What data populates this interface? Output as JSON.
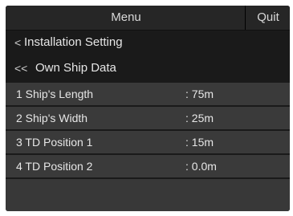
{
  "header": {
    "title": "Menu",
    "quit_label": "Quit"
  },
  "breadcrumb": [
    {
      "icon": "chevron-left-icon",
      "glyph": "<",
      "label": "Installation Setting"
    },
    {
      "icon": "double-chevron-left-icon",
      "glyph": "<<",
      "label": "Own Ship Data"
    }
  ],
  "items": [
    {
      "label": "1 Ship's Length",
      "value": ": 75m"
    },
    {
      "label": "2 Ship's Width",
      "value": ": 25m"
    },
    {
      "label": "3 TD Position 1",
      "value": ": 15m"
    },
    {
      "label": "4 TD Position 2",
      "value": ": 0.0m"
    }
  ],
  "colors": {
    "screen_bg": "#1a1a1a",
    "item_bg": "#3a3a3a",
    "text": "#e6e6e6"
  }
}
